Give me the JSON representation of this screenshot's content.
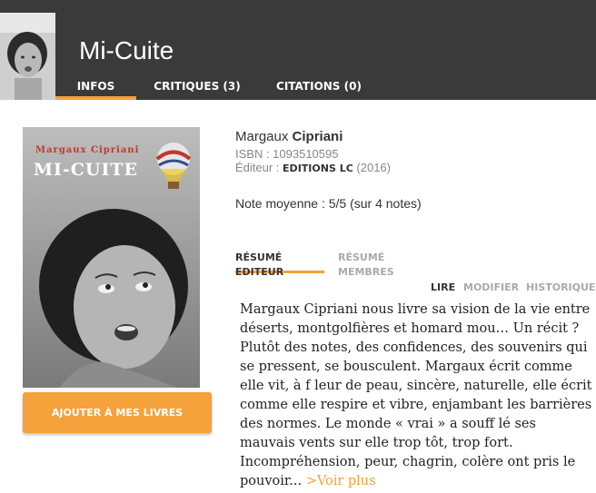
{
  "header": {
    "title": "Mi-Cuite",
    "tabs": [
      {
        "label": "INFOS",
        "active": true
      },
      {
        "label": "CRITIQUES (3)",
        "active": false
      },
      {
        "label": "CITATIONS (0)",
        "active": false
      }
    ]
  },
  "cover": {
    "author_text": "Margaux Cipriani",
    "title_text": "MI-CUITE"
  },
  "book": {
    "author_first": "Margaux",
    "author_last": "Cipriani",
    "isbn": "ISBN : 1093510595",
    "editor_label": "Éditeur :",
    "editor_name": "EDITIONS LC",
    "year": "(2016)",
    "rating": "Note moyenne : 5/5 (sur 4 notes)"
  },
  "add_button": "AJOUTER À MES LIVRES",
  "subtabs": [
    {
      "label": "RÉSUMÉ EDITEUR",
      "active": true
    },
    {
      "label": "RÉSUMÉ MEMBRES",
      "active": false
    }
  ],
  "actions": [
    {
      "label": "LIRE",
      "active": true
    },
    {
      "label": "MODIFIER",
      "active": false
    },
    {
      "label": "HISTORIQUE",
      "active": false
    }
  ],
  "summary": {
    "text": "Margaux Cipriani nous livre sa vision de la vie entre déserts, montgolfières et homard mou… Un récit ? Plutôt des notes, des confidences, des souvenirs qui se pressent, se bousculent. Margaux écrit comme elle vit, à f leur de peau, sincère, naturelle, elle écrit comme elle respire et vibre, enjambant les barrières des normes. Le monde « vrai » a souff lé ses mauvais vents sur elle trop tôt, trop fort. Incompréhension, peur, chagrin, colère ont pris le pouvoir...",
    "more": ">Voir plus"
  },
  "colors": {
    "accent": "#f5a13c",
    "header_bg": "#3a3a3a"
  }
}
